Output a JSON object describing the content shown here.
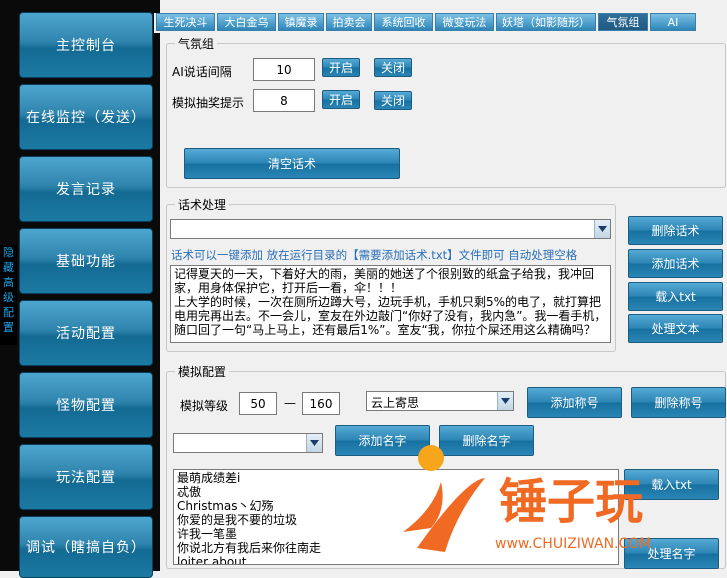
{
  "sidebar": {
    "items": [
      {
        "label": "主控制台"
      },
      {
        "label": "在线监控（发送）"
      },
      {
        "label": "发言记录"
      },
      {
        "label": "基础功能"
      },
      {
        "label": "活动配置"
      },
      {
        "label": "怪物配置"
      },
      {
        "label": "玩法配置"
      },
      {
        "label": "调试（瞎搞自负）"
      }
    ],
    "hidden_config_chars": [
      "隐",
      "藏",
      "高",
      "级",
      "配",
      "置"
    ]
  },
  "tabs": [
    {
      "label": "生死决斗"
    },
    {
      "label": "大白金乌"
    },
    {
      "label": "镇魔录"
    },
    {
      "label": "拍卖会"
    },
    {
      "label": "系统回收"
    },
    {
      "label": "微变玩法"
    },
    {
      "label": "妖塔（如影随形）"
    },
    {
      "label": "气氛组",
      "active": true
    },
    {
      "label": "AI"
    }
  ],
  "atmosphere": {
    "title": "气氛组",
    "ai_interval": {
      "label": "AI说话间隔",
      "value": "10",
      "on": "开启",
      "off": "关闭"
    },
    "lottery_tip": {
      "label": "模拟抽奖提示",
      "value": "8",
      "on": "开启",
      "off": "关闭"
    },
    "clear_button": "清空话术"
  },
  "talk": {
    "title": "话术处理",
    "combo_value": "",
    "note": "话术可以一键添加  放在运行目录的【需要添加话术.txt】文件即可  自动处理空格",
    "content": [
      "记得夏天的一天，下着好大的雨，美丽的她送了个很别致的纸盒子给我，我冲回家，用身体保护它，打开后一看，伞！！！",
      "上大学的时候，一次在厕所边蹲大号，边玩手机，手机只剩5%的电了，就打算把电用完再出去。不一会儿，室友在外边敲门“你好了没有，我内急”。我一看手机，随口回了一句“马上马上，还有最后1%”。室友“我，你拉个屎还用这么精确吗？"
    ],
    "buttons": {
      "delete": "删除话术",
      "add": "添加话术",
      "load": "载入txt",
      "process": "处理文本"
    }
  },
  "sim": {
    "title": "模拟配置",
    "level": {
      "label": "模拟等级",
      "min": "50",
      "dash": "—",
      "max": "160"
    },
    "title_combo": "云上寄思",
    "add_title": "添加称号",
    "delete_title": "删除称号",
    "name_combo": "",
    "add_name": "添加名字",
    "delete_name": "删除名字",
    "names": [
      "最萌成绩差i",
      "忒傲",
      "Christmas丶幻殇",
      "你爱的是我不要的垃圾",
      "许我一笔墨",
      "你说北方有我后来你往南走",
      "loiter about"
    ],
    "right_buttons": {
      "top": "载入txt",
      "bottom": "处理名字"
    }
  },
  "watermark": {
    "text": "锤子玩",
    "url": "www.CHUIZIWAN.COM"
  },
  "colors": {
    "nav_button": "#2f84ad",
    "tab": "#2e86b8",
    "note_text": "#2a6fb8",
    "watermark_orange": "#f06a23"
  }
}
